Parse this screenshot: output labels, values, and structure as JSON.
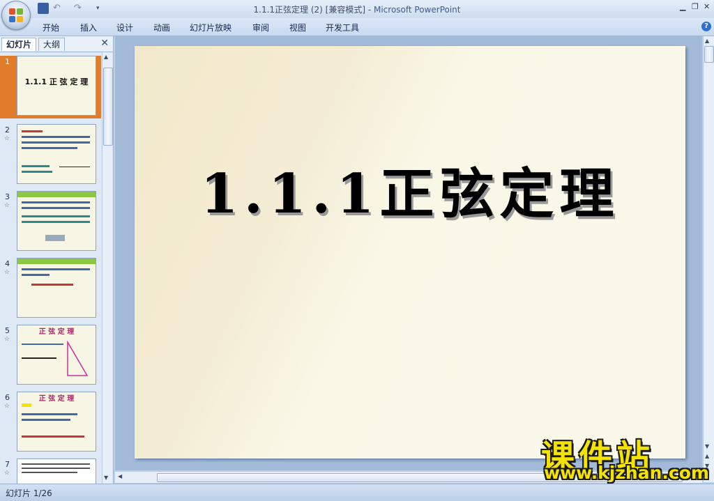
{
  "window": {
    "title_doc": "1.1.1正弦定理 (2) [兼容模式] - ",
    "title_app": "Microsoft PowerPoint",
    "controls": [
      "▁",
      "❐",
      "✕"
    ]
  },
  "ribbon": {
    "tabs": [
      "开始",
      "插入",
      "设计",
      "动画",
      "幻灯片放映",
      "审阅",
      "视图",
      "开发工具"
    ],
    "help_label": "?"
  },
  "left_pane": {
    "tabs": [
      "幻灯片",
      "大纲"
    ],
    "close_label": "✕",
    "slides": [
      {
        "num": "1",
        "title": "1.1.1 正 弦 定 理"
      },
      {
        "num": "2",
        "title": ""
      },
      {
        "num": "3",
        "title": ""
      },
      {
        "num": "4",
        "title": ""
      },
      {
        "num": "5",
        "title": "正 弦 定 理"
      },
      {
        "num": "6",
        "title": "正 弦 定 理"
      },
      {
        "num": "7",
        "title": ""
      }
    ],
    "star": "☆"
  },
  "slide": {
    "title": "1.1.1正弦定理"
  },
  "status": {
    "slide_indicator": "幻灯片 1/26"
  },
  "watermark": {
    "chinese": "课件站",
    "url": "www.kjzhan.com"
  }
}
